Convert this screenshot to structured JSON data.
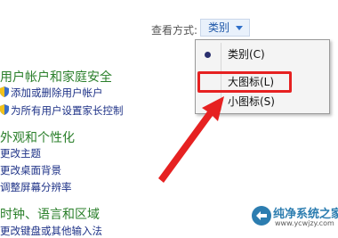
{
  "toolbar": {
    "view_by_label": "查看方式:",
    "view_by_value": "类别"
  },
  "view_menu": {
    "items": [
      {
        "label": "类别(C)",
        "selected": true
      },
      {
        "label": "大图标(L)",
        "selected": false
      },
      {
        "label": "小图标(S)",
        "selected": false
      }
    ],
    "highlight_color": "#e62121"
  },
  "categories": [
    {
      "title": "用户帐户和家庭安全",
      "links": [
        "添加或删除用户帐户",
        "为所有用户设置家长控制"
      ]
    },
    {
      "title": "外观和个性化",
      "links": [
        "更改主题",
        "更改桌面背景",
        "调整屏幕分辨率"
      ]
    },
    {
      "title": "时钟、语言和区域",
      "links": [
        "更改键盘或其他输入法"
      ]
    }
  ],
  "watermark": {
    "text": "纯净系统之家",
    "url": "www.ycwjzy.com"
  },
  "colors": {
    "category_green": "#2a7f2a",
    "link_blue": "#1e3287",
    "arrow_red": "#e62121"
  }
}
